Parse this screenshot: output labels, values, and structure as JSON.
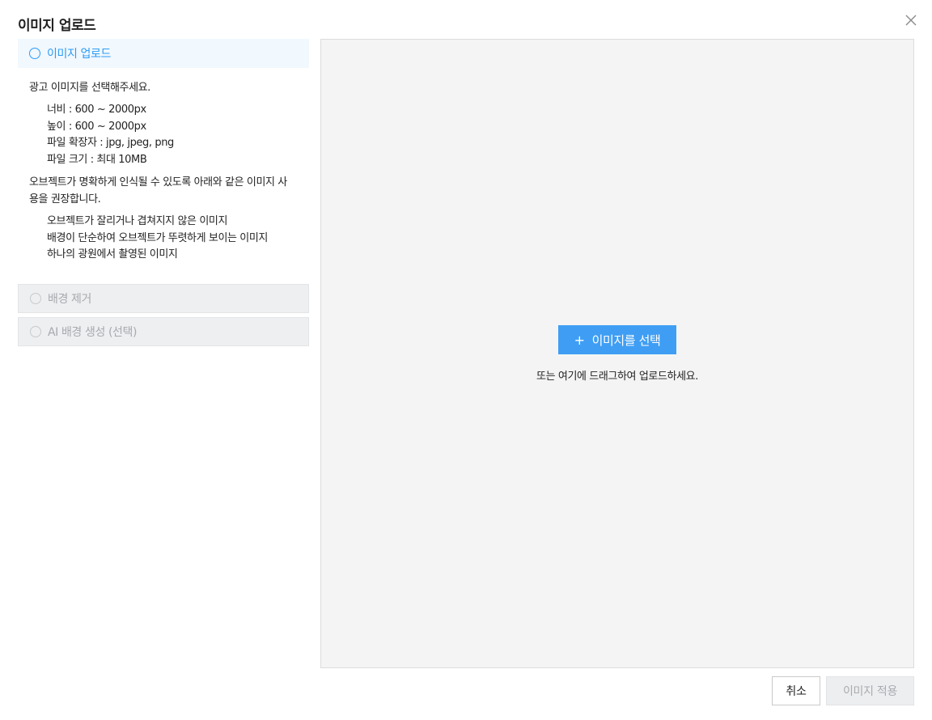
{
  "modal": {
    "title": "이미지 업로드"
  },
  "steps": [
    {
      "label": "이미지 업로드",
      "state": "active",
      "intro": "광고 이미지를 선택해주세요.",
      "specs": [
        "너비 : 600 ~ 2000px",
        "높이 : 600 ~ 2000px",
        "파일 확장자 : jpg, jpeg, png",
        "파일 크기 : 최대 10MB"
      ],
      "recommend": "오브젝트가 명확하게 인식될 수 있도록 아래와 같은 이미지 사용을 권장합니다.",
      "recommendations": [
        "오브젝트가 잘리거나 겹쳐지지 않은 이미지",
        "배경이 단순하여 오브젝트가 뚜렷하게 보이는 이미지",
        "하나의 광원에서 촬영된 이미지"
      ]
    },
    {
      "label": "배경 제거",
      "state": "disabled"
    },
    {
      "label": "AI 배경 생성 (선택)",
      "state": "disabled"
    }
  ],
  "dropzone": {
    "button_plus": "+",
    "button_label": "이미지를 선택",
    "hint": "또는 여기에 드래그하여 업로드하세요."
  },
  "footer": {
    "cancel_label": "취소",
    "apply_label": "이미지 적용"
  },
  "colors": {
    "accent": "#3f9ef4",
    "active_step_bg": "#f1f8fe",
    "disabled_bg": "#eeeff1"
  },
  "icons": {
    "close": "close-icon",
    "step": "radio-circle-icon",
    "add": "plus-icon"
  }
}
